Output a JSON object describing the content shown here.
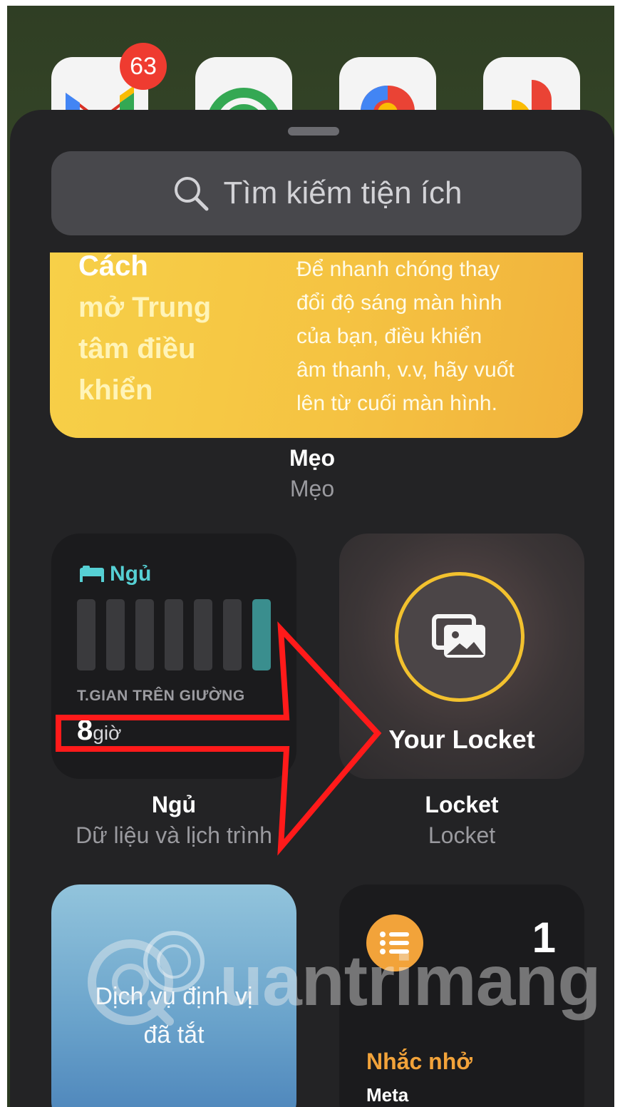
{
  "home": {
    "mail_badge": "63",
    "apps": [
      "gmail-icon",
      "google-one-icon",
      "google-maps-icon",
      "google-photos-icon"
    ]
  },
  "search": {
    "placeholder": "Tìm kiếm tiện ích",
    "icon": "search-icon"
  },
  "tips_widget": {
    "left_line1": "Cách",
    "left_lines": [
      "mở Trung",
      "tâm điều",
      "khiển"
    ],
    "right_text_lines": [
      "Để nhanh chóng thay",
      "đổi độ sáng màn hình",
      "của bạn, điều khiển",
      "âm thanh, v.v, hãy vuốt",
      "lên từ cuối màn hình."
    ],
    "caption_title": "Mẹo",
    "caption_sub": "Mẹo"
  },
  "sleep_widget": {
    "header": "Ngủ",
    "bars": [
      0,
      0,
      0,
      0,
      0,
      0,
      1
    ],
    "label": "T.GIAN TRÊN GIƯỜNG",
    "value": "8",
    "unit": "giờ",
    "caption_title": "Ngủ",
    "caption_sub": "Dữ liệu và lịch trình"
  },
  "locket_widget": {
    "title": "Your Locket",
    "caption_title": "Locket",
    "caption_sub": "Locket",
    "ring_color": "#f2c12e"
  },
  "location_widget": {
    "line1": "Dịch vụ định vị",
    "line2": "đã tắt"
  },
  "reminders_widget": {
    "count": "1",
    "title": "Nhắc nhở",
    "subtitle": "Meta",
    "accent": "#f2a33a"
  },
  "watermark": {
    "text": "uantrimang"
  },
  "annotation": {
    "color": "#ff1a1a"
  }
}
